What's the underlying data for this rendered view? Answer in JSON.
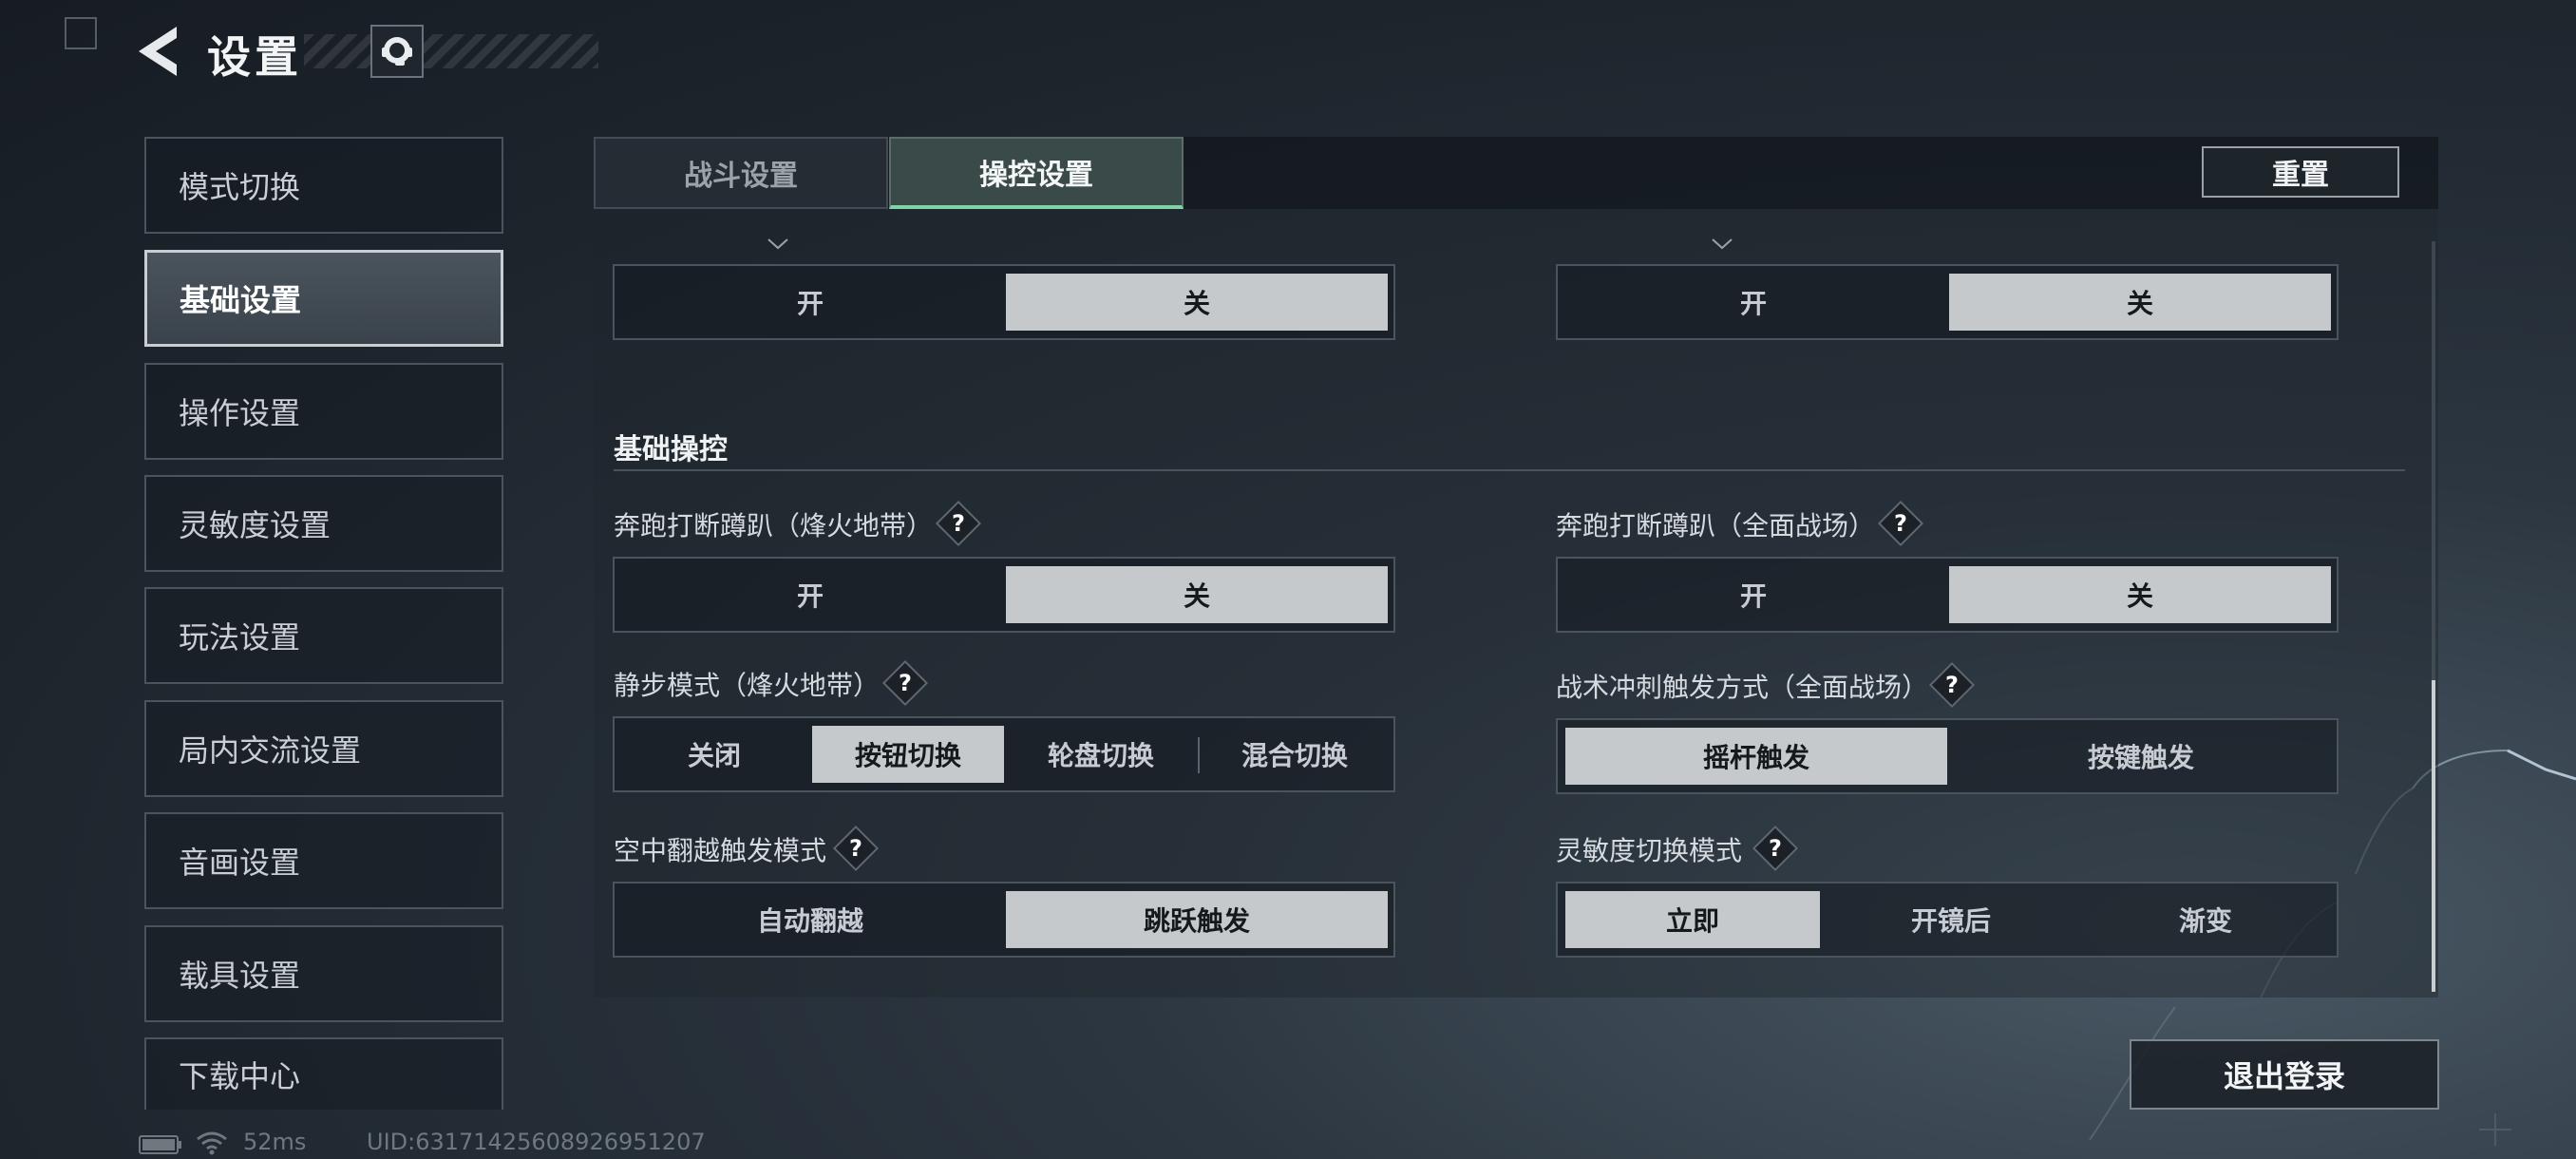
{
  "header": {
    "title": "设置",
    "back_icon": "back-arrow-icon",
    "service_icon": "customer-service-icon"
  },
  "sidebar": {
    "items": [
      {
        "label": "模式切换",
        "active": false
      },
      {
        "label": "基础设置",
        "active": true
      },
      {
        "label": "操作设置",
        "active": false
      },
      {
        "label": "灵敏度设置",
        "active": false
      },
      {
        "label": "玩法设置",
        "active": false
      },
      {
        "label": "局内交流设置",
        "active": false
      },
      {
        "label": "音画设置",
        "active": false
      },
      {
        "label": "载具设置",
        "active": false
      },
      {
        "label": "下载中心",
        "active": false
      }
    ]
  },
  "tabs": [
    {
      "label": "战斗设置",
      "active": false
    },
    {
      "label": "操控设置",
      "active": true
    }
  ],
  "reset_label": "重置",
  "top_toggles": {
    "left": {
      "options": [
        "开",
        "关"
      ],
      "selected": "关"
    },
    "right": {
      "options": [
        "开",
        "关"
      ],
      "selected": "关"
    }
  },
  "section": {
    "title": "基础操控",
    "settings": [
      {
        "label": "奔跑打断蹲趴（烽火地带）",
        "help": "?",
        "options": [
          "开",
          "关"
        ],
        "selected": "关"
      },
      {
        "label": "奔跑打断蹲趴（全面战场）",
        "help": "?",
        "options": [
          "开",
          "关"
        ],
        "selected": "关"
      },
      {
        "label": "静步模式（烽火地带）",
        "help": "?",
        "options": [
          "关闭",
          "按钮切换",
          "轮盘切换",
          "混合切换"
        ],
        "selected": "按钮切换"
      },
      {
        "label": "战术冲刺触发方式（全面战场）",
        "help": "?",
        "options": [
          "摇杆触发",
          "按键触发"
        ],
        "selected": "摇杆触发"
      },
      {
        "label": "空中翻越触发模式",
        "help": "?",
        "options": [
          "自动翻越",
          "跳跃触发"
        ],
        "selected": "跳跃触发"
      },
      {
        "label": "灵敏度切换模式",
        "help": "?",
        "options": [
          "立即",
          "开镜后",
          "渐变"
        ],
        "selected": "立即"
      }
    ]
  },
  "logout_label": "退出登录",
  "status_bar": {
    "ping": "52ms",
    "uid": "UID:6317142560892695120​7"
  },
  "colors": {
    "accent": "#7fd3a8",
    "selected_option": "#c6c9cc",
    "background": "#1e262e"
  }
}
